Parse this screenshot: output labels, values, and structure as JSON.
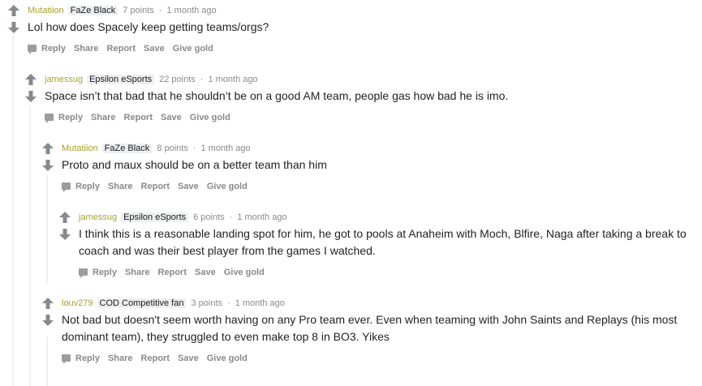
{
  "comments": [
    {
      "author": "Mutatiion",
      "flair": "FaZe Black",
      "points": "7 points",
      "separator": "·",
      "time": "1 month ago",
      "text": "Lol how does Spacely keep getting teams/orgs?",
      "actions": {
        "reply": "Reply",
        "share": "Share",
        "report": "Report",
        "save": "Save",
        "gold": "Give gold"
      }
    },
    {
      "author": "jamessug",
      "flair": "Epsilon eSports",
      "points": "22 points",
      "separator": "·",
      "time": "1 month ago",
      "text": "Space isn’t that bad that he shouldn’t be on a good AM team, people gas how bad he is imo.",
      "actions": {
        "reply": "Reply",
        "share": "Share",
        "report": "Report",
        "save": "Save",
        "gold": "Give gold"
      }
    },
    {
      "author": "Mutatiion",
      "flair": "FaZe Black",
      "points": "8 points",
      "separator": "·",
      "time": "1 month ago",
      "text": "Proto and maux should be on a better team than him",
      "actions": {
        "reply": "Reply",
        "share": "Share",
        "report": "Report",
        "save": "Save",
        "gold": "Give gold"
      }
    },
    {
      "author": "jamessug",
      "flair": "Epsilon eSports",
      "points": "6 points",
      "separator": "·",
      "time": "1 month ago",
      "text": "I think this is a reasonable landing spot for him, he got to pools at Anaheim with Moch, Blfire, Naga after taking a break to coach and was their best player from the games I watched.",
      "actions": {
        "reply": "Reply",
        "share": "Share",
        "report": "Report",
        "save": "Save",
        "gold": "Give gold"
      }
    },
    {
      "author": "louv279",
      "flair": "COD Competitive fan",
      "points": "3 points",
      "separator": "·",
      "time": "1 month ago",
      "text": "Not bad but doesn't seem worth having on any Pro team ever. Even when teaming with John Saints and Replays (his most dominant team), they struggled to even make top 8 in BO3. Yikes",
      "actions": {
        "reply": "Reply",
        "share": "Share",
        "report": "Report",
        "save": "Save",
        "gold": "Give gold"
      }
    }
  ],
  "colors": {
    "author": "#a5a426",
    "arrow": "#878a8c",
    "meta": "#878a8c",
    "thread_line": "#edeff1"
  },
  "icons": {
    "upvote": "up-arrow-icon",
    "downvote": "down-arrow-icon",
    "reply": "speech-bubble-icon"
  }
}
